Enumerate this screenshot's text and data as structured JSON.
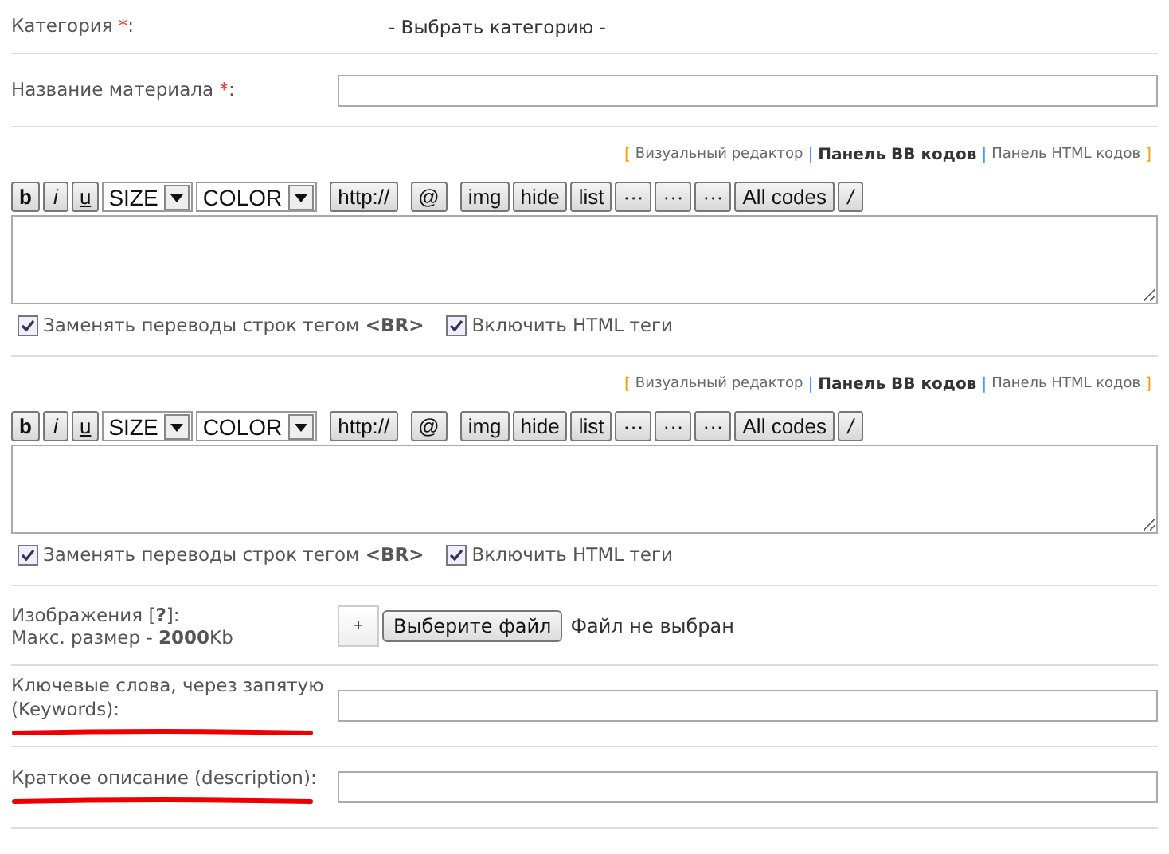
{
  "rows": [
    {
      "kind": "select",
      "label": "Категория",
      "required_mark": "*",
      "label_end": ":",
      "value": "- Выбрать категорию -"
    },
    {
      "kind": "text",
      "label": "Название материала",
      "required_mark": "*",
      "label_end": ":"
    },
    {
      "kind": "editor",
      "modes": {
        "open": "[",
        "close": "]",
        "separator": "|",
        "items": [
          {
            "label": "Визуальный редактор",
            "selected": false
          },
          {
            "label": "Панель BB кодов",
            "selected": true
          },
          {
            "label": "Панель HTML кодов",
            "selected": false
          }
        ]
      },
      "toolbar": [
        {
          "kind": "b",
          "label": "b"
        },
        {
          "kind": "i",
          "label": "i"
        },
        {
          "kind": "u",
          "label": "u"
        },
        {
          "kind": "select",
          "label": "SIZE"
        },
        {
          "kind": "select",
          "label": "COLOR"
        },
        {
          "kind": "button",
          "label": "http://",
          "spaced": true
        },
        {
          "kind": "button",
          "label": "@",
          "spaced": true
        },
        {
          "kind": "button",
          "label": "img",
          "spaced": true
        },
        {
          "kind": "button",
          "label": "hide"
        },
        {
          "kind": "button",
          "label": "list"
        },
        {
          "kind": "button",
          "label": "···"
        },
        {
          "kind": "button",
          "label": "···"
        },
        {
          "kind": "button",
          "label": "···"
        },
        {
          "kind": "button",
          "label": "All codes"
        },
        {
          "kind": "i",
          "label": "/"
        }
      ],
      "options": [
        {
          "label": "Заменять переводы строк тегом **<BR>**",
          "checked": true
        },
        {
          "label": "Включить HTML теги",
          "checked": true
        }
      ]
    },
    {
      "kind": "editor",
      "modes": {
        "open": "[",
        "close": "]",
        "separator": "|",
        "items": [
          {
            "label": "Визуальный редактор",
            "selected": false
          },
          {
            "label": "Панель BB кодов",
            "selected": true
          },
          {
            "label": "Панель HTML кодов",
            "selected": false
          }
        ]
      },
      "toolbar": [
        {
          "kind": "b",
          "label": "b"
        },
        {
          "kind": "i",
          "label": "i"
        },
        {
          "kind": "u",
          "label": "u"
        },
        {
          "kind": "select",
          "label": "SIZE"
        },
        {
          "kind": "select",
          "label": "COLOR"
        },
        {
          "kind": "button",
          "label": "http://",
          "spaced": true
        },
        {
          "kind": "button",
          "label": "@",
          "spaced": true
        },
        {
          "kind": "button",
          "label": "img",
          "spaced": true
        },
        {
          "kind": "button",
          "label": "hide"
        },
        {
          "kind": "button",
          "label": "list"
        },
        {
          "kind": "button",
          "label": "···"
        },
        {
          "kind": "button",
          "label": "···"
        },
        {
          "kind": "button",
          "label": "···"
        },
        {
          "kind": "button",
          "label": "All codes"
        },
        {
          "kind": "i",
          "label": "/"
        }
      ],
      "options": [
        {
          "label": "Заменять переводы строк тегом **<BR>**",
          "checked": true
        },
        {
          "label": "Включить HTML теги",
          "checked": true
        }
      ]
    },
    {
      "kind": "image",
      "label_lines": [
        "Изображения [**?**]:",
        "Макс. размер - **2000**Kb"
      ],
      "add_button": "+",
      "file_button": "Выберите файл",
      "file_status": "Файл не выбран"
    },
    {
      "kind": "text",
      "label": "Ключевые слова, через запятую (Keywords):",
      "underlined": true
    },
    {
      "kind": "text",
      "label": "Краткое описание (description):",
      "underlined": true
    }
  ]
}
